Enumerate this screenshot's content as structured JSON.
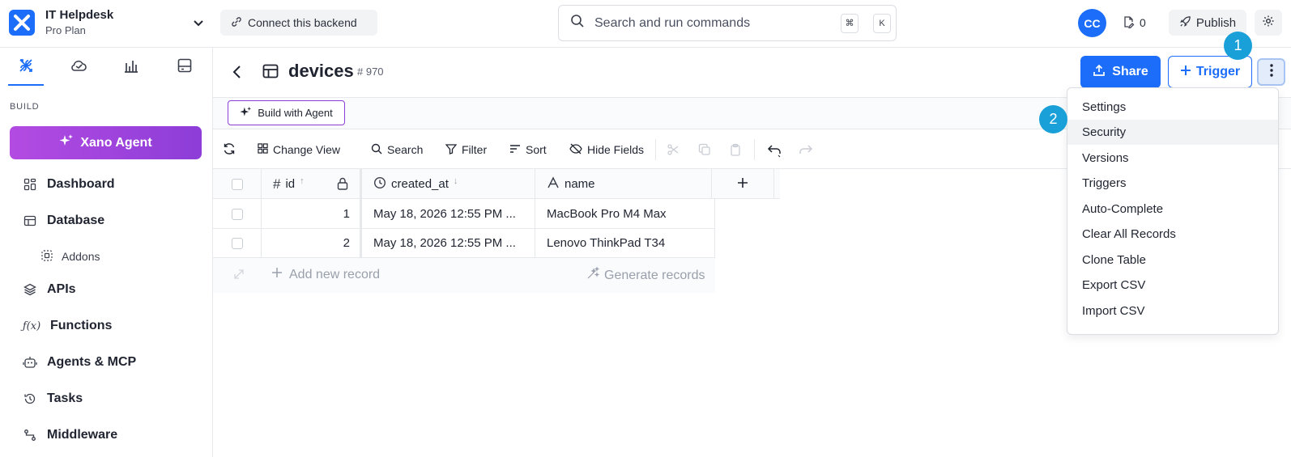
{
  "topbar": {
    "workspace_name": "IT Helpdesk",
    "workspace_plan": "Pro Plan",
    "connect_label": "Connect this backend",
    "search_placeholder": "Search and run commands",
    "shortcut_key1": "⌘",
    "shortcut_key2": "K",
    "avatar_initials": "CC",
    "count": "0",
    "publish_label": "Publish"
  },
  "sidebar": {
    "section_label": "BUILD",
    "agent_label": "Xano Agent",
    "items": [
      {
        "label": "Dashboard",
        "icon": "grid-icon"
      },
      {
        "label": "Database",
        "icon": "table-icon"
      },
      {
        "label": "Addons",
        "icon": "addons-icon"
      },
      {
        "label": "APIs",
        "icon": "layers-icon"
      },
      {
        "label": "Functions",
        "icon": "function-icon"
      },
      {
        "label": "Agents & MCP",
        "icon": "robot-icon"
      },
      {
        "label": "Tasks",
        "icon": "history-icon"
      },
      {
        "label": "Middleware",
        "icon": "route-icon"
      }
    ]
  },
  "header": {
    "title": "devices",
    "table_id": "# 970",
    "share_label": "Share",
    "trigger_label": "Trigger"
  },
  "agentbar": {
    "build_label": "Build with Agent"
  },
  "toolbar": {
    "change_view": "Change View",
    "search": "Search",
    "filter": "Filter",
    "sort": "Sort",
    "hide_fields": "Hide Fields"
  },
  "grid": {
    "columns": [
      "id",
      "created_at",
      "name"
    ],
    "rows": [
      {
        "id": "1",
        "created_at": "May 18, 2026 12:55 PM ...",
        "name": "MacBook Pro M4 Max"
      },
      {
        "id": "2",
        "created_at": "May 18, 2026 12:55 PM ...",
        "name": "Lenovo ThinkPad T34"
      }
    ],
    "add_record": "Add new record",
    "generate_records": "Generate records"
  },
  "menu": {
    "items": [
      "Settings",
      "Security",
      "Versions",
      "Triggers",
      "Auto-Complete",
      "Clear All Records",
      "Clone Table",
      "Export CSV",
      "Import CSV"
    ],
    "highlighted": "Security"
  },
  "annotations": {
    "badge1": "1",
    "badge2": "2"
  },
  "colors": {
    "accent": "#1b6dfa",
    "agent_purple": "#9b45dd",
    "badge": "#1aa0d8"
  }
}
